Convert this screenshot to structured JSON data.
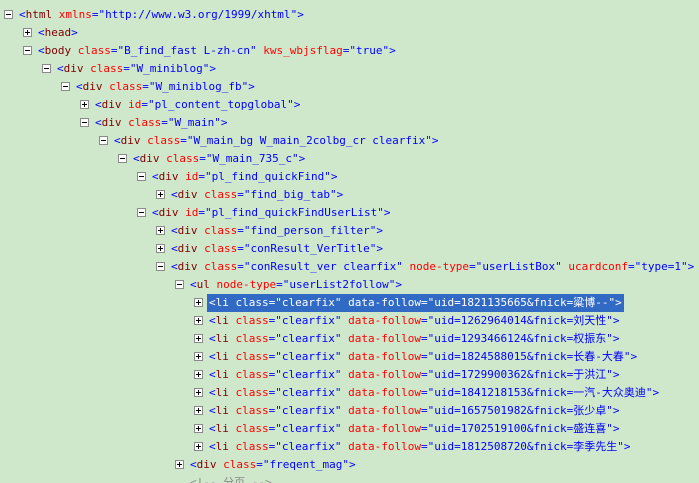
{
  "tree": {
    "nodes": [
      {
        "depth": 0,
        "toggle": "minus",
        "tag": "html",
        "attrs": [
          {
            "name": "xmlns",
            "value": "http://www.w3.org/1999/xhtml"
          }
        ]
      },
      {
        "depth": 1,
        "toggle": "plus",
        "tag": "head",
        "attrs": []
      },
      {
        "depth": 1,
        "toggle": "minus",
        "tag": "body",
        "attrs": [
          {
            "name": "class",
            "value": "B_find_fast L-zh-cn"
          },
          {
            "name": "kws_wbjsflag",
            "value": "true"
          }
        ]
      },
      {
        "depth": 2,
        "toggle": "minus",
        "tag": "div",
        "attrs": [
          {
            "name": "class",
            "value": "W_miniblog"
          }
        ]
      },
      {
        "depth": 3,
        "toggle": "minus",
        "tag": "div",
        "attrs": [
          {
            "name": "class",
            "value": "W_miniblog_fb"
          }
        ]
      },
      {
        "depth": 4,
        "toggle": "plus",
        "tag": "div",
        "attrs": [
          {
            "name": "id",
            "value": "pl_content_topglobal"
          }
        ]
      },
      {
        "depth": 4,
        "toggle": "minus",
        "tag": "div",
        "attrs": [
          {
            "name": "class",
            "value": "W_main"
          }
        ]
      },
      {
        "depth": 5,
        "toggle": "minus",
        "tag": "div",
        "attrs": [
          {
            "name": "class",
            "value": "W_main_bg W_main_2colbg_cr clearfix"
          }
        ]
      },
      {
        "depth": 6,
        "toggle": "minus",
        "tag": "div",
        "attrs": [
          {
            "name": "class",
            "value": "W_main_735_c"
          }
        ]
      },
      {
        "depth": 7,
        "toggle": "minus",
        "tag": "div",
        "attrs": [
          {
            "name": "id",
            "value": "pl_find_quickFind"
          }
        ]
      },
      {
        "depth": 8,
        "toggle": "plus",
        "tag": "div",
        "attrs": [
          {
            "name": "class",
            "value": "find_big_tab"
          }
        ]
      },
      {
        "depth": 7,
        "toggle": "minus",
        "tag": "div",
        "attrs": [
          {
            "name": "id",
            "value": "pl_find_quickFindUserList"
          }
        ]
      },
      {
        "depth": 8,
        "toggle": "plus",
        "tag": "div",
        "attrs": [
          {
            "name": "class",
            "value": "find_person_filter"
          }
        ]
      },
      {
        "depth": 8,
        "toggle": "plus",
        "tag": "div",
        "attrs": [
          {
            "name": "class",
            "value": "conResult_VerTitle"
          }
        ]
      },
      {
        "depth": 8,
        "toggle": "minus",
        "tag": "div",
        "attrs": [
          {
            "name": "class",
            "value": "conResult_ver clearfix"
          },
          {
            "name": "node-type",
            "value": "userListBox"
          },
          {
            "name": "ucardconf",
            "value": "type=1"
          }
        ]
      },
      {
        "depth": 9,
        "toggle": "minus",
        "tag": "ul",
        "attrs": [
          {
            "name": "node-type",
            "value": "userList2follow"
          }
        ]
      },
      {
        "depth": 10,
        "toggle": "plus",
        "tag": "li",
        "selected": true,
        "attrs": [
          {
            "name": "class",
            "value": "clearfix"
          },
          {
            "name": "data-follow",
            "value": "uid=1821135665&fnick=粱博--"
          }
        ]
      },
      {
        "depth": 10,
        "toggle": "plus",
        "tag": "li",
        "attrs": [
          {
            "name": "class",
            "value": "clearfix"
          },
          {
            "name": "data-follow",
            "value": "uid=1262964014&fnick=刘天性"
          }
        ]
      },
      {
        "depth": 10,
        "toggle": "plus",
        "tag": "li",
        "attrs": [
          {
            "name": "class",
            "value": "clearfix"
          },
          {
            "name": "data-follow",
            "value": "uid=1293466124&fnick=权振东"
          }
        ]
      },
      {
        "depth": 10,
        "toggle": "plus",
        "tag": "li",
        "attrs": [
          {
            "name": "class",
            "value": "clearfix"
          },
          {
            "name": "data-follow",
            "value": "uid=1824588015&fnick=长春-大春"
          }
        ]
      },
      {
        "depth": 10,
        "toggle": "plus",
        "tag": "li",
        "attrs": [
          {
            "name": "class",
            "value": "clearfix"
          },
          {
            "name": "data-follow",
            "value": "uid=1729900362&fnick=于洪江"
          }
        ]
      },
      {
        "depth": 10,
        "toggle": "plus",
        "tag": "li",
        "attrs": [
          {
            "name": "class",
            "value": "clearfix"
          },
          {
            "name": "data-follow",
            "value": "uid=1841218153&fnick=一汽-大众奥迪"
          }
        ]
      },
      {
        "depth": 10,
        "toggle": "plus",
        "tag": "li",
        "attrs": [
          {
            "name": "class",
            "value": "clearfix"
          },
          {
            "name": "data-follow",
            "value": "uid=1657501982&fnick=张少卓"
          }
        ]
      },
      {
        "depth": 10,
        "toggle": "plus",
        "tag": "li",
        "attrs": [
          {
            "name": "class",
            "value": "clearfix"
          },
          {
            "name": "data-follow",
            "value": "uid=1702519100&fnick=盛连喜"
          }
        ]
      },
      {
        "depth": 10,
        "toggle": "plus",
        "tag": "li",
        "attrs": [
          {
            "name": "class",
            "value": "clearfix"
          },
          {
            "name": "data-follow",
            "value": "uid=1812508720&fnick=李季先生"
          }
        ]
      },
      {
        "depth": 9,
        "toggle": "plus",
        "tag": "div",
        "attrs": [
          {
            "name": "class",
            "value": "freqent_mag"
          }
        ]
      },
      {
        "depth": 9,
        "toggle": "none",
        "tag": "!--",
        "partial": true,
        "attrs": [],
        "text": "分页 --"
      }
    ]
  },
  "colors": {
    "background": "#cfe8cc",
    "tag_bracket": "#0000ff",
    "tag_name": "#800000",
    "attr_name": "#ff0000",
    "attr_value": "#0000ff",
    "selection": "#316ac5"
  }
}
